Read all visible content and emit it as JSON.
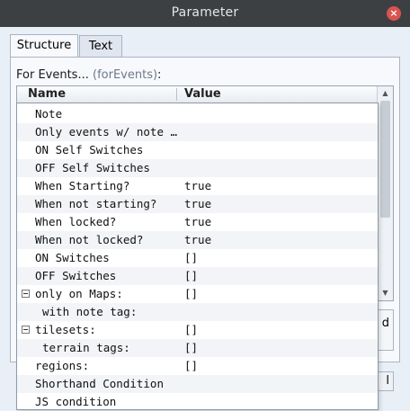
{
  "window": {
    "title": "Parameter",
    "close_glyph": "×"
  },
  "tabs": [
    {
      "label": "Structure",
      "active": true
    },
    {
      "label": "Text",
      "active": false
    }
  ],
  "group": {
    "label": "For Events...",
    "hint": "(forEvents)",
    "suffix": ":"
  },
  "table": {
    "col_name": "Name",
    "col_value": "Value"
  },
  "side_button": {
    "label": "d"
  },
  "bottom_button": {
    "label": "l"
  },
  "list": [
    {
      "name": "Note",
      "value": ""
    },
    {
      "name": "Only events w/ note …",
      "value": ""
    },
    {
      "name": "ON Self Switches",
      "value": ""
    },
    {
      "name": "OFF Self Switches",
      "value": ""
    },
    {
      "name": "When Starting?",
      "value": "true"
    },
    {
      "name": "When not starting?",
      "value": "true"
    },
    {
      "name": "When locked?",
      "value": "true"
    },
    {
      "name": "When not locked?",
      "value": "true"
    },
    {
      "name": "ON Switches",
      "value": "[]"
    },
    {
      "name": "OFF Switches",
      "value": "[]"
    },
    {
      "name": "only on Maps:",
      "value": "[]",
      "expander": true
    },
    {
      "name": "with note tag:",
      "value": "",
      "indent": true
    },
    {
      "name": "tilesets:",
      "value": "[]",
      "expander": true
    },
    {
      "name": "terrain tags:",
      "value": "[]",
      "indent": true
    },
    {
      "name": "regions:",
      "value": "[]"
    },
    {
      "name": "Shorthand Condition",
      "value": ""
    },
    {
      "name": "JS condition",
      "value": ""
    }
  ],
  "colors": {
    "titlebar": "#3c4043",
    "close": "#d9534f",
    "background": "#e9eff7"
  }
}
